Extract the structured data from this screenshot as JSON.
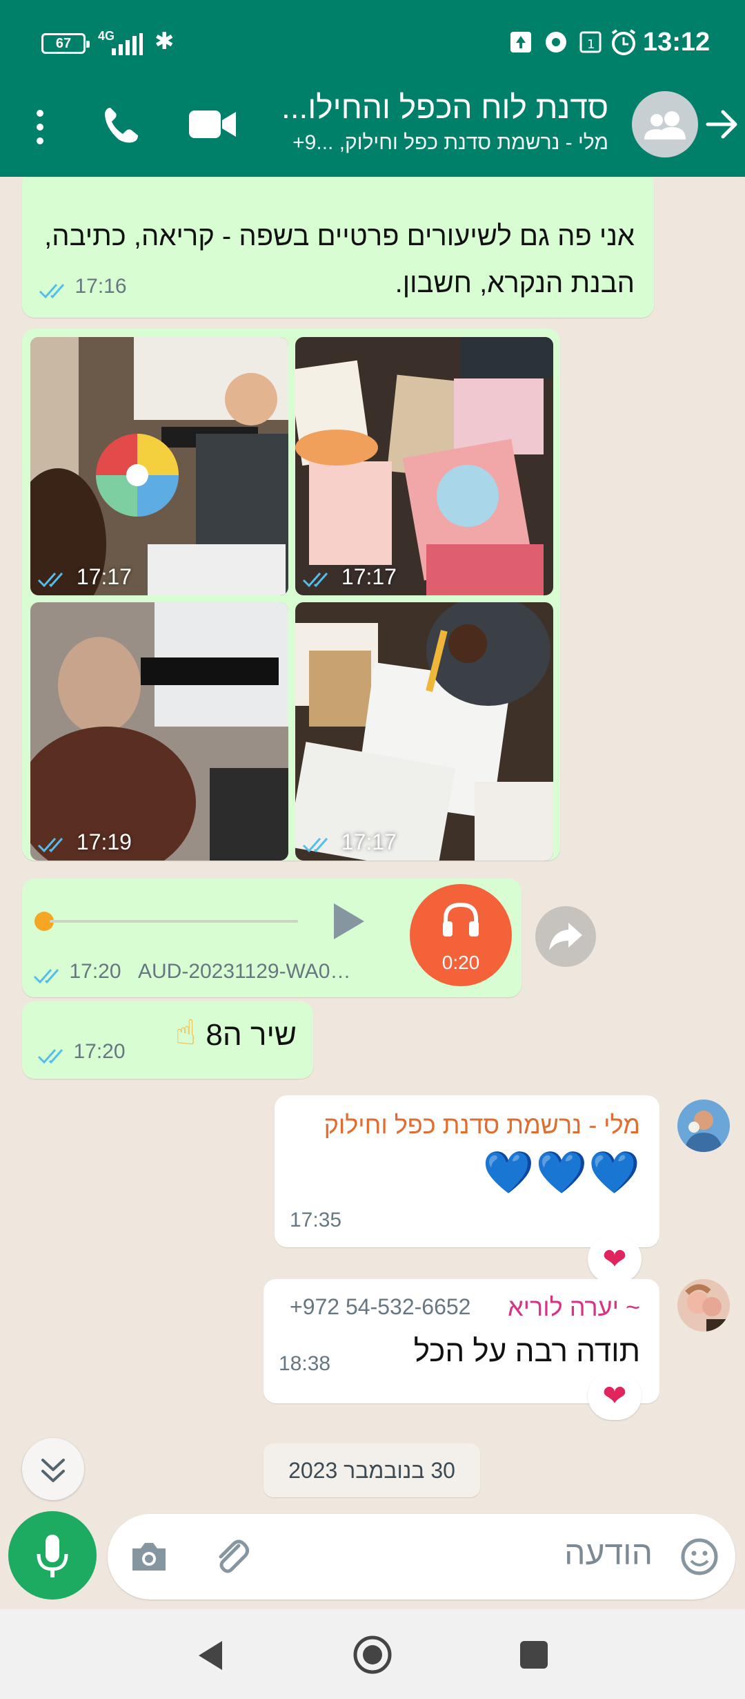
{
  "status_bar": {
    "battery": "67",
    "network": "4G",
    "time": "13:12"
  },
  "header": {
    "title": "סדנת לוח הכפל והחילו...",
    "subtitle": "מלי - נרשמת סדנת כפל וחילוק, ...9+"
  },
  "messages": {
    "m1": {
      "text": "אני פה גם לשיעורים פרטיים בשפה - קריאה, כתיבה, הבנת הנקרא, חשבון.",
      "time": "17:16"
    },
    "photos": [
      {
        "time": "17:17"
      },
      {
        "time": "17:17"
      },
      {
        "time": "17:19"
      },
      {
        "time": "17:17"
      }
    ],
    "audio": {
      "duration": "0:20",
      "time": "17:20",
      "filename": "AUD-20231129-WA0…"
    },
    "m4": {
      "text": "שיר ה8",
      "emoji": "☝",
      "time": "17:20"
    },
    "m5": {
      "sender": "מלי - נרשמת סדנת כפל וחילוק",
      "text": "💙💙💙",
      "time": "17:35",
      "reaction": "❤"
    },
    "m6": {
      "sender": "~ יערה לוריא",
      "phone": "+972 54-532-6652",
      "text": "תודה רבה על הכל",
      "time": "18:38",
      "reaction": "❤"
    }
  },
  "date_chip": "30 בנובמבר 2023",
  "input": {
    "placeholder": "הודעה"
  },
  "colors": {
    "header": "#008069",
    "outgoing": "#d9fdd3",
    "incoming": "#ffffff",
    "audio_avatar": "#f4623a",
    "sender1": "#e06c2f",
    "sender2": "#d63384",
    "mic": "#1daa61"
  }
}
